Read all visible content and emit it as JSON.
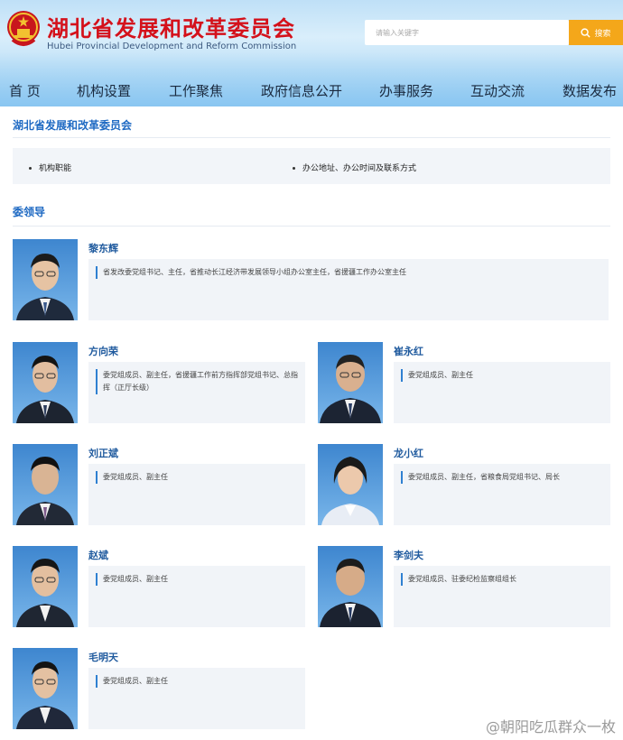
{
  "header": {
    "title_cn": "湖北省发展和改革委员会",
    "title_en": "Hubei Provincial Development and Reform Commission",
    "search_placeholder": "请输入关键字",
    "search_button": "搜索"
  },
  "nav": [
    "首 页",
    "机构设置",
    "工作聚焦",
    "政府信息公开",
    "办事服务",
    "互动交流",
    "数据发布"
  ],
  "section1": {
    "title": "湖北省发展和改革委员会",
    "links": [
      "机构职能",
      "办公地址、办公时间及联系方式"
    ]
  },
  "section2": {
    "title": "委领导"
  },
  "leaders": [
    {
      "name": "黎东辉",
      "desc": "省发改委党组书记、主任，省推动长江经济带发展领导小组办公室主任，省援疆工作办公室主任"
    },
    {
      "name": "方向荣",
      "desc": "委党组成员、副主任，省援疆工作前方指挥部党组书记、总指挥（正厅长级）"
    },
    {
      "name": "崔永红",
      "desc": "委党组成员、副主任"
    },
    {
      "name": "刘正斌",
      "desc": "委党组成员、副主任"
    },
    {
      "name": "龙小红",
      "desc": "委党组成员、副主任，省粮食局党组书记、局长"
    },
    {
      "name": "赵斌",
      "desc": "委党组成员、副主任"
    },
    {
      "name": "李剑夫",
      "desc": "委党组成员、驻委纪检监察组组长"
    },
    {
      "name": "毛明天",
      "desc": "委党组成员、副主任"
    }
  ],
  "watermark": "@朝阳吃瓜群众一枚"
}
